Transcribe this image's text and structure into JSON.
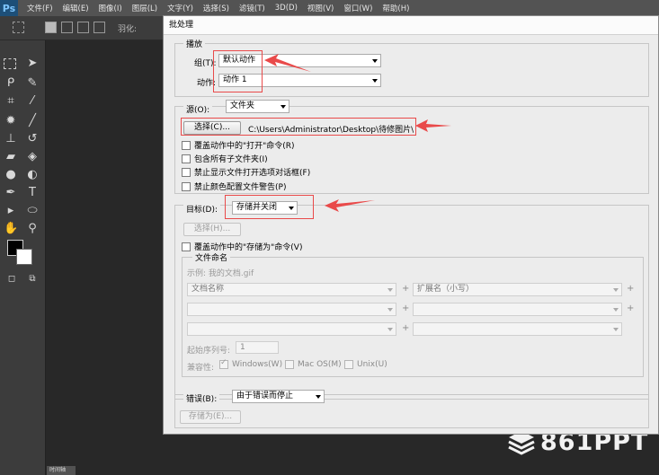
{
  "menubar": {
    "logo": "Ps",
    "items": [
      "文件(F)",
      "编辑(E)",
      "图像(I)",
      "图层(L)",
      "文字(Y)",
      "选择(S)",
      "滤镜(T)",
      "3D(D)",
      "视图(V)",
      "窗口(W)",
      "帮助(H)"
    ]
  },
  "optbar": {
    "feather_label": "羽化:"
  },
  "canvas_tab": "时间轴",
  "dialog": {
    "title": "批处理",
    "play": {
      "legend": "播放",
      "group_label": "组(T):",
      "group_value": "默认动作",
      "action_label": "动作:",
      "action_value": "动作 1"
    },
    "source": {
      "label": "源(O):",
      "value": "文件夹",
      "choose_button": "选择(C)...",
      "path": "C:\\Users\\Administrator\\Desktop\\待修图片\\",
      "checkboxes": [
        "覆盖动作中的\"打开\"命令(R)",
        "包含所有子文件夹(I)",
        "禁止显示文件打开选项对话框(F)",
        "禁止颜色配置文件警告(P)"
      ]
    },
    "destination": {
      "label": "目标(D):",
      "value": "存储并关闭",
      "choose_button": "选择(H)...",
      "override_checkbox": "覆盖动作中的\"存储为\"命令(V)",
      "naming": {
        "legend": "文件命名",
        "example": "示例: 我的文档.gif",
        "field1": "文档名称",
        "field2": "扩展名（小写）",
        "start_serial_label": "起始序列号:",
        "start_serial_value": "1",
        "compat_label": "兼容性:",
        "compat": [
          "Windows(W)",
          "Mac OS(M)",
          "Unix(U)"
        ]
      }
    },
    "errors": {
      "label": "错误(B):",
      "value": "由于错误而停止",
      "save_as_button": "存储为(E)..."
    }
  },
  "watermark": "861PPT",
  "colors": {
    "annotation_red": "#e94a4a",
    "ps_blue": "#1d4f78"
  }
}
